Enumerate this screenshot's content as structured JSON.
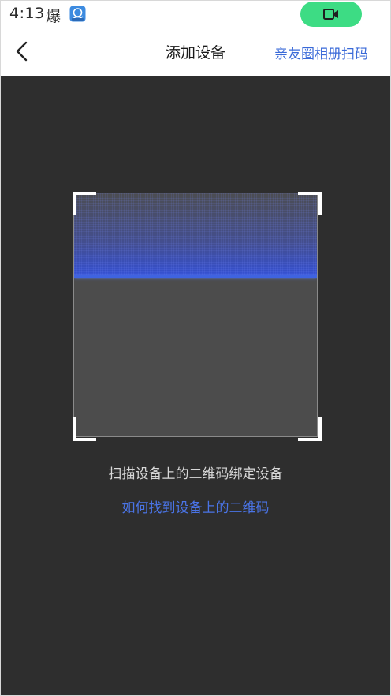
{
  "status_bar": {
    "time": "4:13",
    "notification_char": "爆",
    "app_icon": "blue-app-icon",
    "call_icon": "video-camera-icon",
    "call_pill_color": "#3ddc84"
  },
  "nav": {
    "back_icon": "chevron-left-icon",
    "title": "添加设备",
    "action_label": "亲友圈相册扫码"
  },
  "scanner": {
    "hint": "扫描设备上的二维码绑定设备",
    "help_link": "如何找到设备上的二维码",
    "scan_line_color": "#3f63e0"
  },
  "colors": {
    "accent": "#3a6ad8",
    "scanner_bg": "#2e2e2e"
  }
}
